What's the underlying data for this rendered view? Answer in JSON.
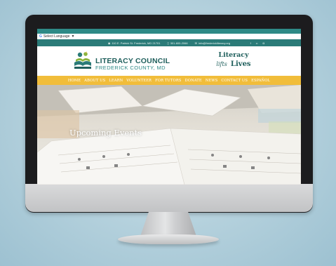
{
  "translate": {
    "label": "Select Language",
    "arrow": "▼"
  },
  "info_bar": {
    "address": "110 E. Patrick St. Frederick, MD 21701",
    "phone": "301-600-2066",
    "email": "info@frederickliteracy.org",
    "social_icons": [
      "facebook-icon",
      "flickr-icon",
      "instagram-icon"
    ]
  },
  "logo": {
    "title": "LITERACY COUNCIL",
    "subtitle": "FREDERICK COUNTY, MD"
  },
  "tagline": {
    "line1": "Literacy",
    "line2": "lifts",
    "line3": "Lives"
  },
  "nav": {
    "items": [
      "HOME",
      "ABOUT US",
      "LEARN",
      "VOLUNTEER",
      "FOR TUTORS",
      "DONATE",
      "NEWS",
      "CONTACT US",
      "ESPAÑOL"
    ]
  },
  "hero": {
    "title": "Upcoming Events"
  },
  "colors": {
    "teal": "#2b7b78",
    "nav_yellow": "#f1bd3a",
    "logo_teal": "#1f5f5c",
    "logo_green": "#8ab43c",
    "logo_yellow": "#f1bd3a"
  }
}
